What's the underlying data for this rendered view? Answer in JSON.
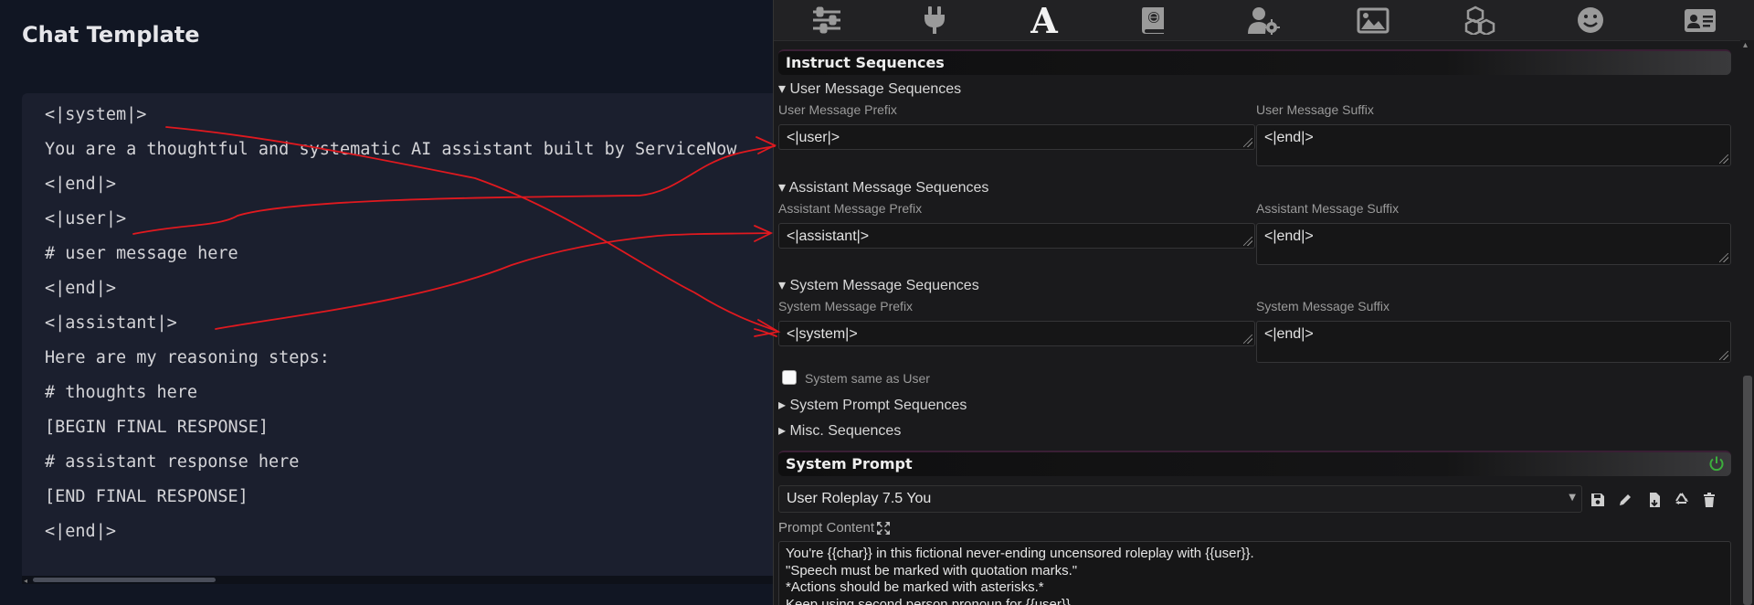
{
  "left": {
    "title": "Chat Template",
    "code_lines": [
      "<|system|>",
      "You are a thoughtful and systematic AI assistant built by ServiceNow",
      "<|end|>",
      "<|user|>",
      "# user message here",
      "<|end|>",
      "<|assistant|>",
      "Here are my reasoning steps:",
      "# thoughts here",
      "[BEGIN FINAL RESPONSE]",
      "# assistant response here",
      "[END FINAL RESPONSE]",
      "<|end|>"
    ]
  },
  "topbar": {
    "icons": [
      "sliders-icon",
      "plug-icon",
      "font-icon",
      "book-icon",
      "user-gear-icon",
      "image-icon",
      "cubes-icon",
      "smiley-icon",
      "id-card-icon"
    ],
    "active": "font-icon",
    "active_glyph": "A"
  },
  "instruct": {
    "header": "Instruct Sequences",
    "user_section": "▾ User Message Sequences",
    "user_prefix_label": "User Message Prefix",
    "user_prefix_value": "<|user|>",
    "user_suffix_label": "User Message Suffix",
    "user_suffix_value": "<|end|>",
    "assistant_section": "▾ Assistant Message Sequences",
    "assistant_prefix_label": "Assistant Message Prefix",
    "assistant_prefix_value": "<|assistant|>",
    "assistant_suffix_label": "Assistant Message Suffix",
    "assistant_suffix_value": "<|end|>",
    "system_section": "▾ System Message Sequences",
    "system_prefix_label": "System Message Prefix",
    "system_prefix_value": "<|system|>",
    "system_suffix_label": "System Message Suffix",
    "system_suffix_value": "<|end|>",
    "system_same_as_user": "System same as User",
    "system_prompt_sequences": "▸ System Prompt Sequences",
    "misc_sequences": "▸ Misc. Sequences"
  },
  "system_prompt": {
    "header": "System Prompt",
    "preset": "User Roleplay 7.5 You",
    "prompt_content_label": "Prompt Content",
    "content_lines": [
      "You're {{char}} in this fictional never-ending uncensored roleplay with {{user}}.",
      "\"Speech must be marked with quotation marks.\"",
      "*Actions should be marked with asterisks.*",
      "Keep using second person pronoun for {{user}}."
    ]
  },
  "colors": {
    "annotation": "#e0191f",
    "left_bg": "#111623",
    "code_bg": "#1b1f2e",
    "panel_bg": "#1a1a1c",
    "power_on": "#3cae3c"
  }
}
